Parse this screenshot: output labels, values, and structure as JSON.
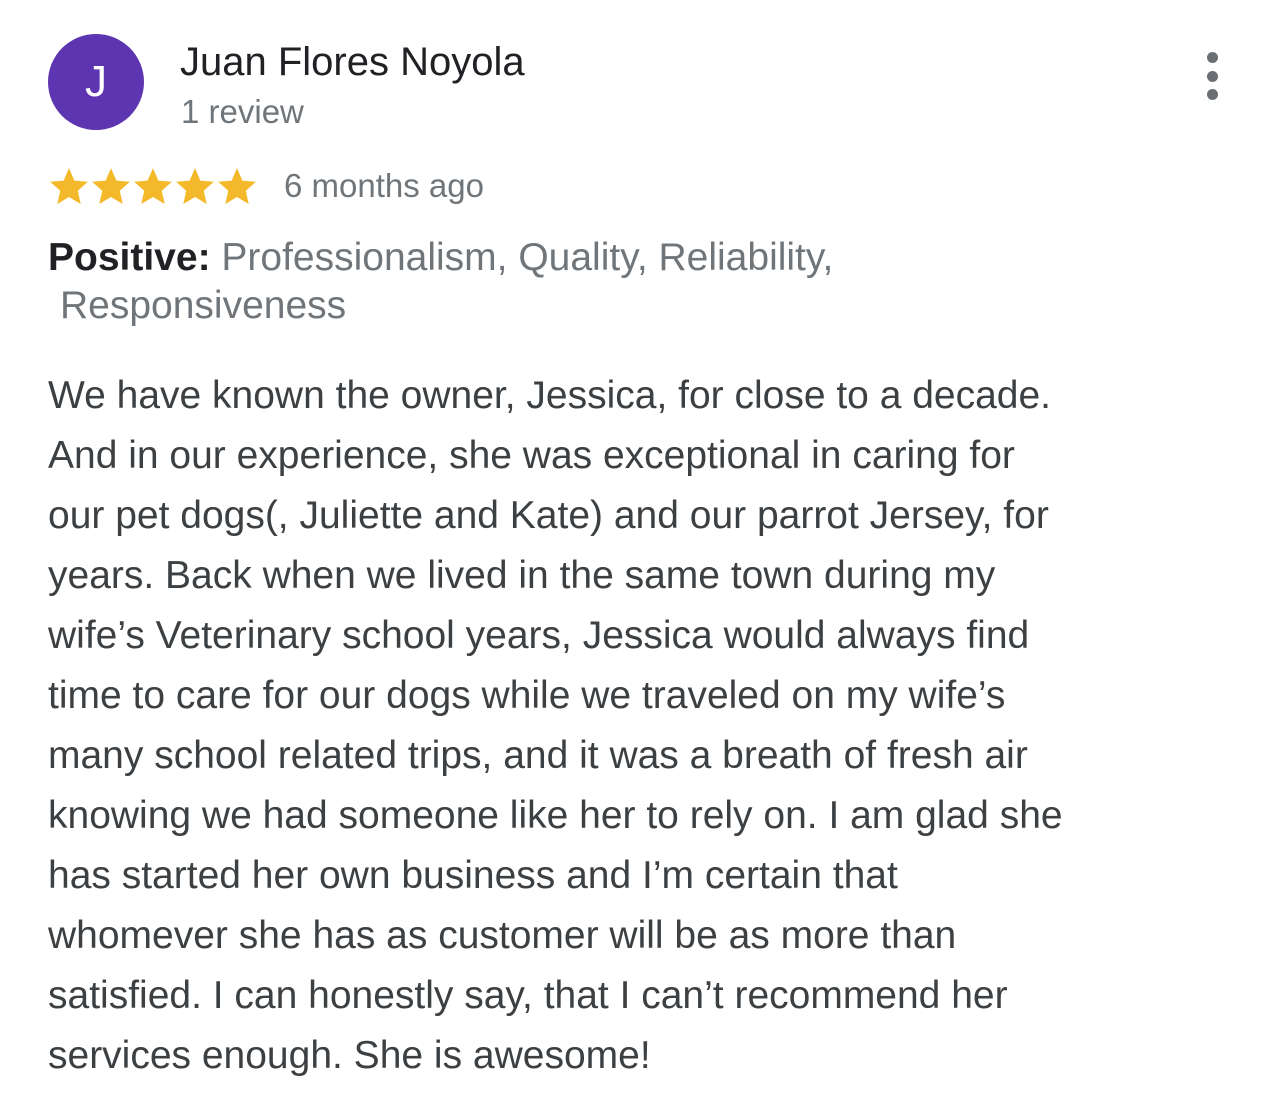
{
  "reviewer": {
    "initial": "J",
    "name": "Juan Flores Noyola",
    "review_count": "1 review",
    "avatar_color": "#5e35b1"
  },
  "menu": {
    "icon": "more-vert-icon"
  },
  "rating": {
    "stars": 5,
    "max_stars": 5,
    "star_color": "#f4b92b",
    "time_ago": "6 months ago"
  },
  "attributes": {
    "label": "Positive:",
    "values_line1": "Professionalism, Quality, Reliability,",
    "values_line2": "Responsiveness"
  },
  "review_text": {
    "lines": [
      "We have known the owner, Jessica, for close to a decade.",
      "And in our experience, she was exceptional in caring for",
      "our pet dogs(, Juliette and Kate) and our parrot Jersey, for",
      "years. Back when we lived in the same town during my",
      "wife’s Veterinary school years, Jessica would always find",
      "time to care for our dogs while we traveled on my wife’s",
      "many school related trips, and it was a breath of fresh air",
      "knowing we had someone like her to rely on. I am glad she",
      "has started her own business and I’m certain that",
      "whomever she has as customer will be as more than",
      "satisfied. I can honestly say, that I can’t recommend her",
      "services enough. She is awesome!"
    ]
  }
}
